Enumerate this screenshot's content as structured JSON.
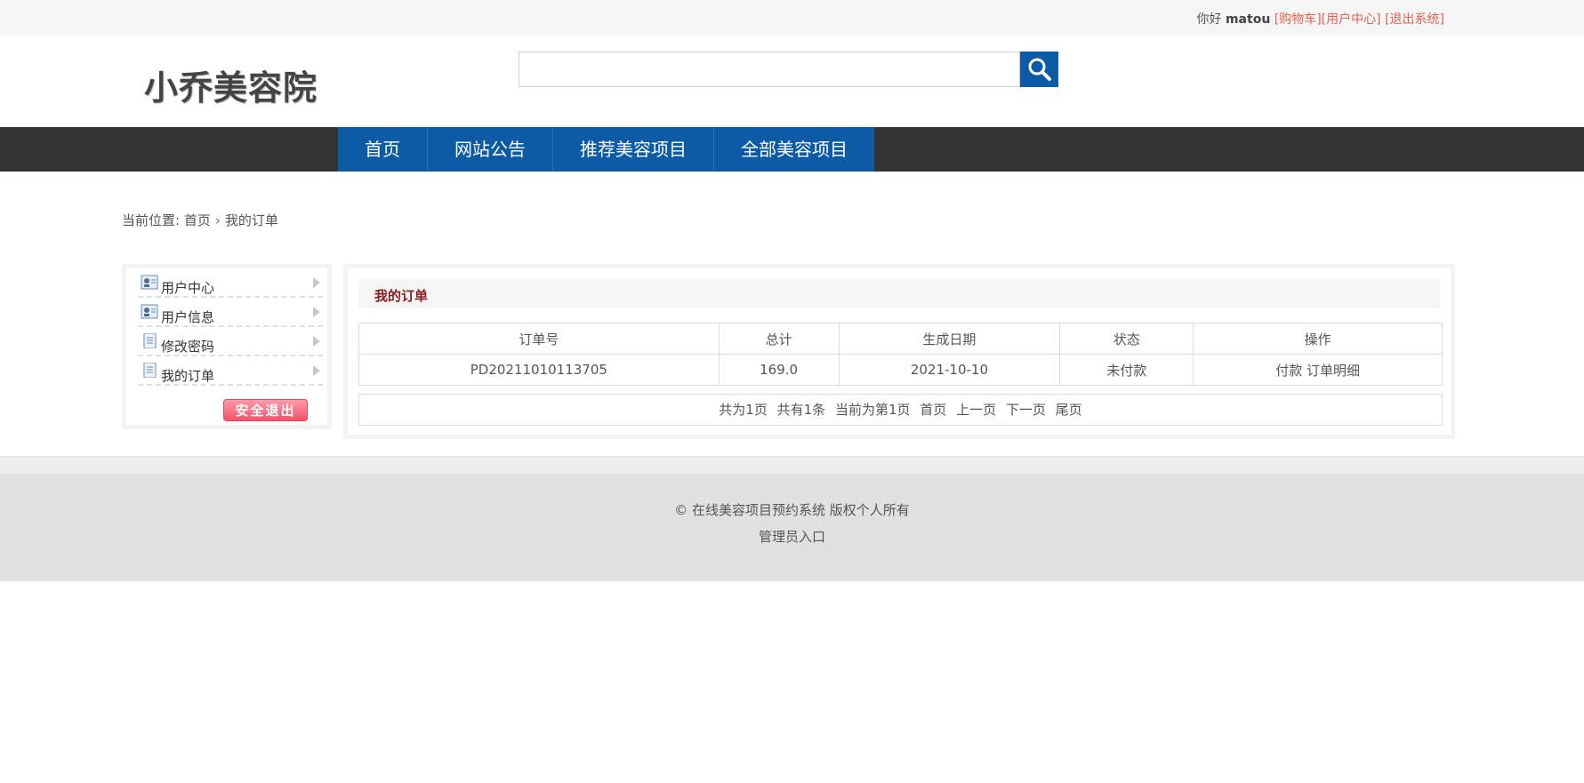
{
  "topbar": {
    "greeting": "你好",
    "username": "matou",
    "links": [
      "[购物车]",
      "[用户中心]",
      "[退出系统]"
    ]
  },
  "header": {
    "logo_text": "小乔美容院",
    "search_placeholder": ""
  },
  "nav": {
    "items": [
      "首页",
      "网站公告",
      "推荐美容项目",
      "全部美容项目"
    ]
  },
  "breadcrumb": {
    "prefix": "当前位置:",
    "home": "首页",
    "current": "我的订单"
  },
  "sidebar": {
    "items": [
      "用户中心",
      "用户信息",
      "修改密码",
      "我的订单"
    ],
    "logout_label": "安全退出"
  },
  "main": {
    "title": "我的订单",
    "table": {
      "headers": [
        "订单号",
        "总计",
        "生成日期",
        "状态",
        "操作"
      ],
      "rows": [
        {
          "order_no": "PD20211010113705",
          "total": "169.0",
          "date": "2021-10-10",
          "status": "未付款",
          "actions": [
            "付款",
            "订单明细"
          ]
        }
      ]
    },
    "pager": {
      "total_pages": "共为1页",
      "total_items": "共有1条",
      "current": "当前为第1页",
      "first": "首页",
      "prev": "上一页",
      "next": "下一页",
      "last": "尾页"
    }
  },
  "footer": {
    "copyright": "© 在线美容项目预约系统 版权个人所有",
    "admin_link": "管理员入口"
  },
  "colors": {
    "nav_blue": "#0d5aa6",
    "nav_bar": "#333333",
    "link_red": "#e8604e",
    "title_red": "#8b1a1a"
  }
}
